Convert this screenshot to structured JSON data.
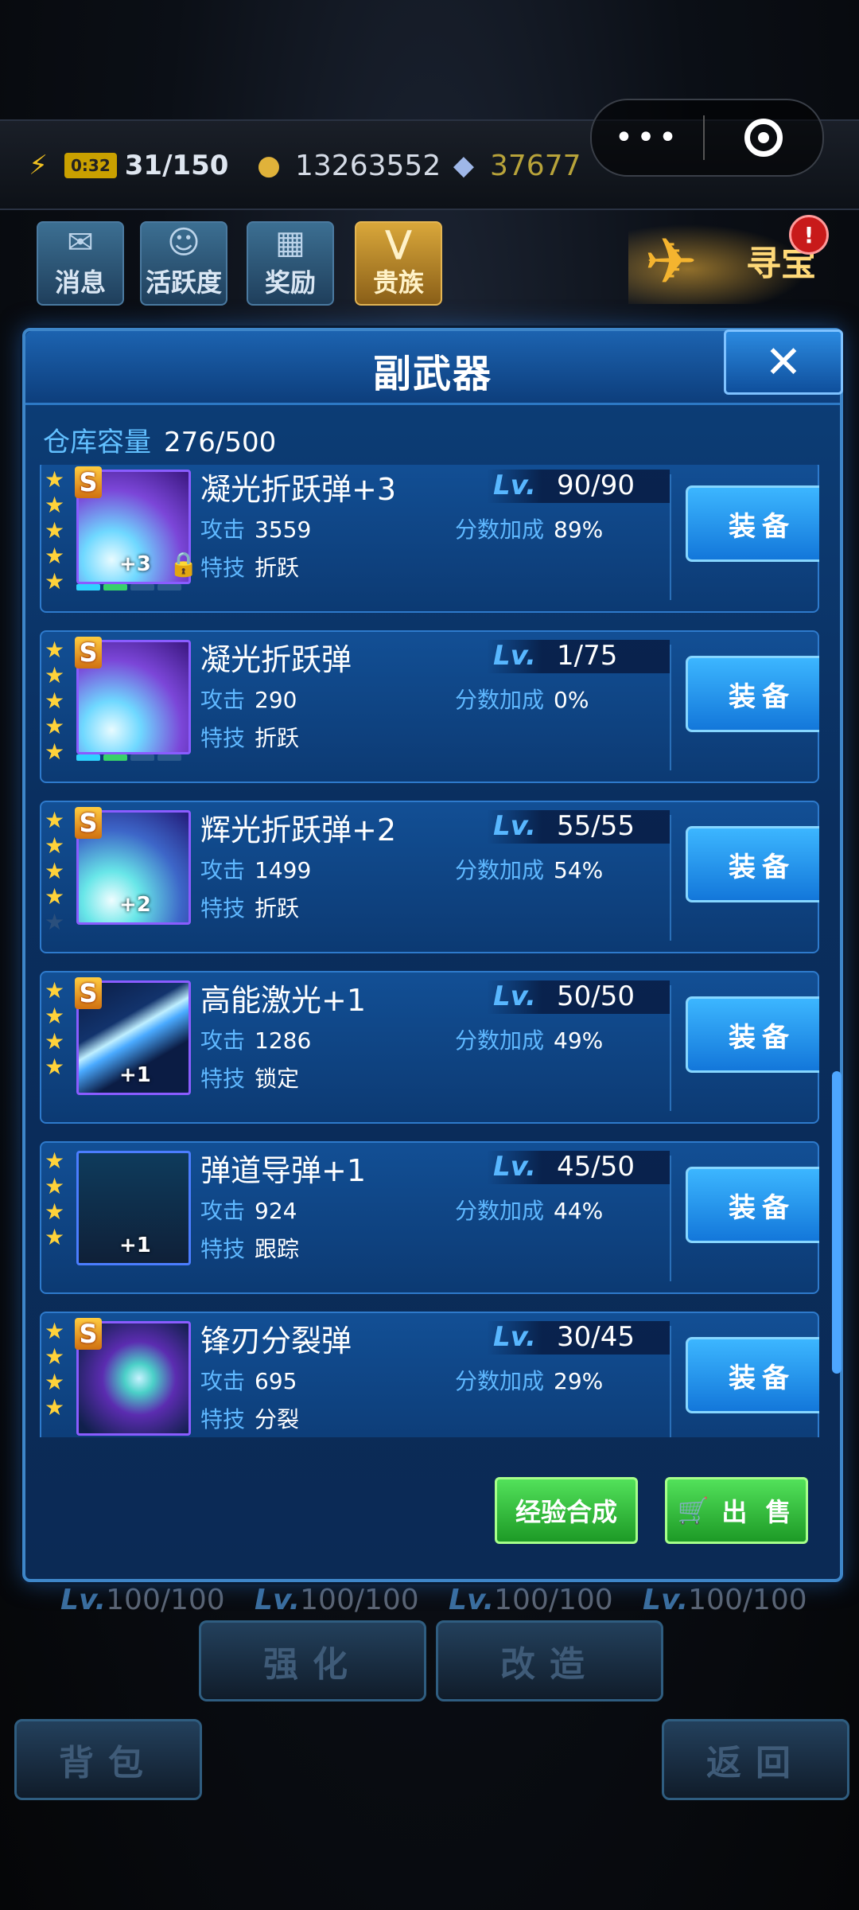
{
  "topbar": {
    "timer": "0:32",
    "energy": "31/150",
    "coins": "13263552",
    "gems": "37677"
  },
  "menu": {
    "items": [
      {
        "label": "消息"
      },
      {
        "label": "活跃度"
      },
      {
        "label": "奖励"
      },
      {
        "label": "贵族"
      }
    ],
    "treasure_label": "寻宝",
    "badge": "!"
  },
  "dialog": {
    "title": "副武器",
    "close": "✕",
    "capacity_label": "仓库容量",
    "capacity_value": "276/500",
    "attack_label": "攻击",
    "skill_label": "特技",
    "bonus_label": "分数加成",
    "lv_label": "Lv.",
    "equip_label": "装备",
    "items": [
      {
        "name": "凝光折跃弹+3",
        "level": "90/90",
        "attack": "3559",
        "bonus": "89%",
        "skill": "折跃",
        "plus": "+3"
      },
      {
        "name": "凝光折跃弹",
        "level": "1/75",
        "attack": "290",
        "bonus": "0%",
        "skill": "折跃",
        "plus": ""
      },
      {
        "name": "辉光折跃弹+2",
        "level": "55/55",
        "attack": "1499",
        "bonus": "54%",
        "skill": "折跃",
        "plus": "+2"
      },
      {
        "name": "高能激光+1",
        "level": "50/50",
        "attack": "1286",
        "bonus": "49%",
        "skill": "锁定",
        "plus": "+1"
      },
      {
        "name": "弹道导弹+1",
        "level": "45/50",
        "attack": "924",
        "bonus": "44%",
        "skill": "跟踪",
        "plus": "+1"
      },
      {
        "name": "锋刃分裂弹",
        "level": "30/45",
        "attack": "695",
        "bonus": "29%",
        "skill": "分裂",
        "plus": ""
      }
    ],
    "merge_label": "经验合成",
    "sell_label": "出 售"
  },
  "background": {
    "lv_values": [
      "100/100",
      "100/100",
      "100/100",
      "100/100"
    ],
    "lv_label": "Lv.",
    "enhance": "强化",
    "modify": "改造",
    "bag": "背包",
    "back": "返回"
  }
}
